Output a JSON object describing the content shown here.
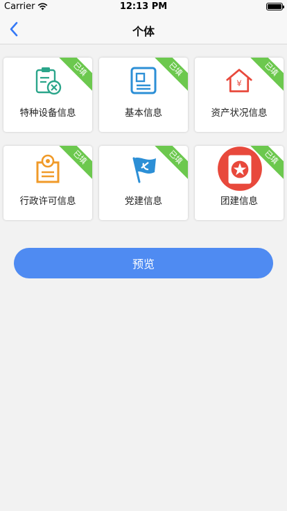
{
  "status_bar": {
    "carrier": "Carrier",
    "time": "12:13 PM",
    "battery_level": 0.95
  },
  "nav": {
    "title": "个体",
    "back_icon": "chevron-left-icon"
  },
  "cards": [
    {
      "label": "特种设备信息",
      "badge": "已填",
      "icon": "equipment-tools-icon"
    },
    {
      "label": "基本信息",
      "badge": "已填",
      "icon": "id-card-icon"
    },
    {
      "label": "资产状况信息",
      "badge": "已填",
      "icon": "house-yen-icon"
    },
    {
      "label": "行政许可信息",
      "badge": "已填",
      "icon": "license-certificate-icon"
    },
    {
      "label": "党建信息",
      "badge": "已填",
      "icon": "party-flag-icon"
    },
    {
      "label": "团建信息",
      "badge": "已填",
      "icon": "league-badge-icon"
    }
  ],
  "preview_button": {
    "label": "预览"
  },
  "colors": {
    "accent": "#4f8bf2",
    "badge": "#6cc84e",
    "teal": "#2aa58a",
    "blue": "#2c8fd6",
    "red": "#e8493c",
    "orange": "#f09a28"
  }
}
